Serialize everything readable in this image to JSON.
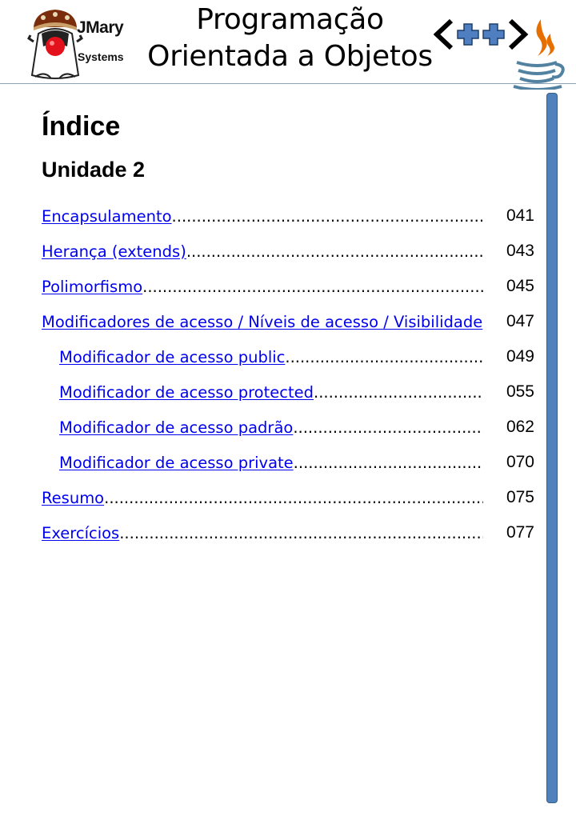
{
  "header": {
    "logo": {
      "brand": "JMary",
      "sub": "Systems",
      "icon": "jmary-mascot-icon"
    },
    "title_line1": "Programação",
    "title_line2": "Orientada a Objetos",
    "icons": [
      "cpp-icon",
      "java-icon"
    ],
    "cpp_text": "<++>"
  },
  "colors": {
    "link": "#0000ee",
    "side_bar": "#4f81bd",
    "header_rule": "#8aa3b8"
  },
  "content": {
    "heading": "Índice",
    "unit": "Unidade 2"
  },
  "toc": {
    "entries": [
      {
        "label": "Encapsulamento",
        "page": "041"
      },
      {
        "label": "Herança (extends)",
        "page": "043"
      },
      {
        "label": "Polimorfismo",
        "page": "045"
      },
      {
        "label": "Modificadores de acesso / Níveis de acesso / Visibilidade",
        "page": "047"
      },
      {
        "label": "Modificador de acesso public",
        "page": "049"
      },
      {
        "label": "Modificador de acesso protected",
        "page": "055"
      },
      {
        "label": "Modificador de acesso padrão",
        "page": "062"
      },
      {
        "label": "Modificador de acesso private",
        "page": "070"
      },
      {
        "label": "Resumo",
        "page": "075"
      },
      {
        "label": "Exercícios",
        "page": "077"
      }
    ]
  }
}
